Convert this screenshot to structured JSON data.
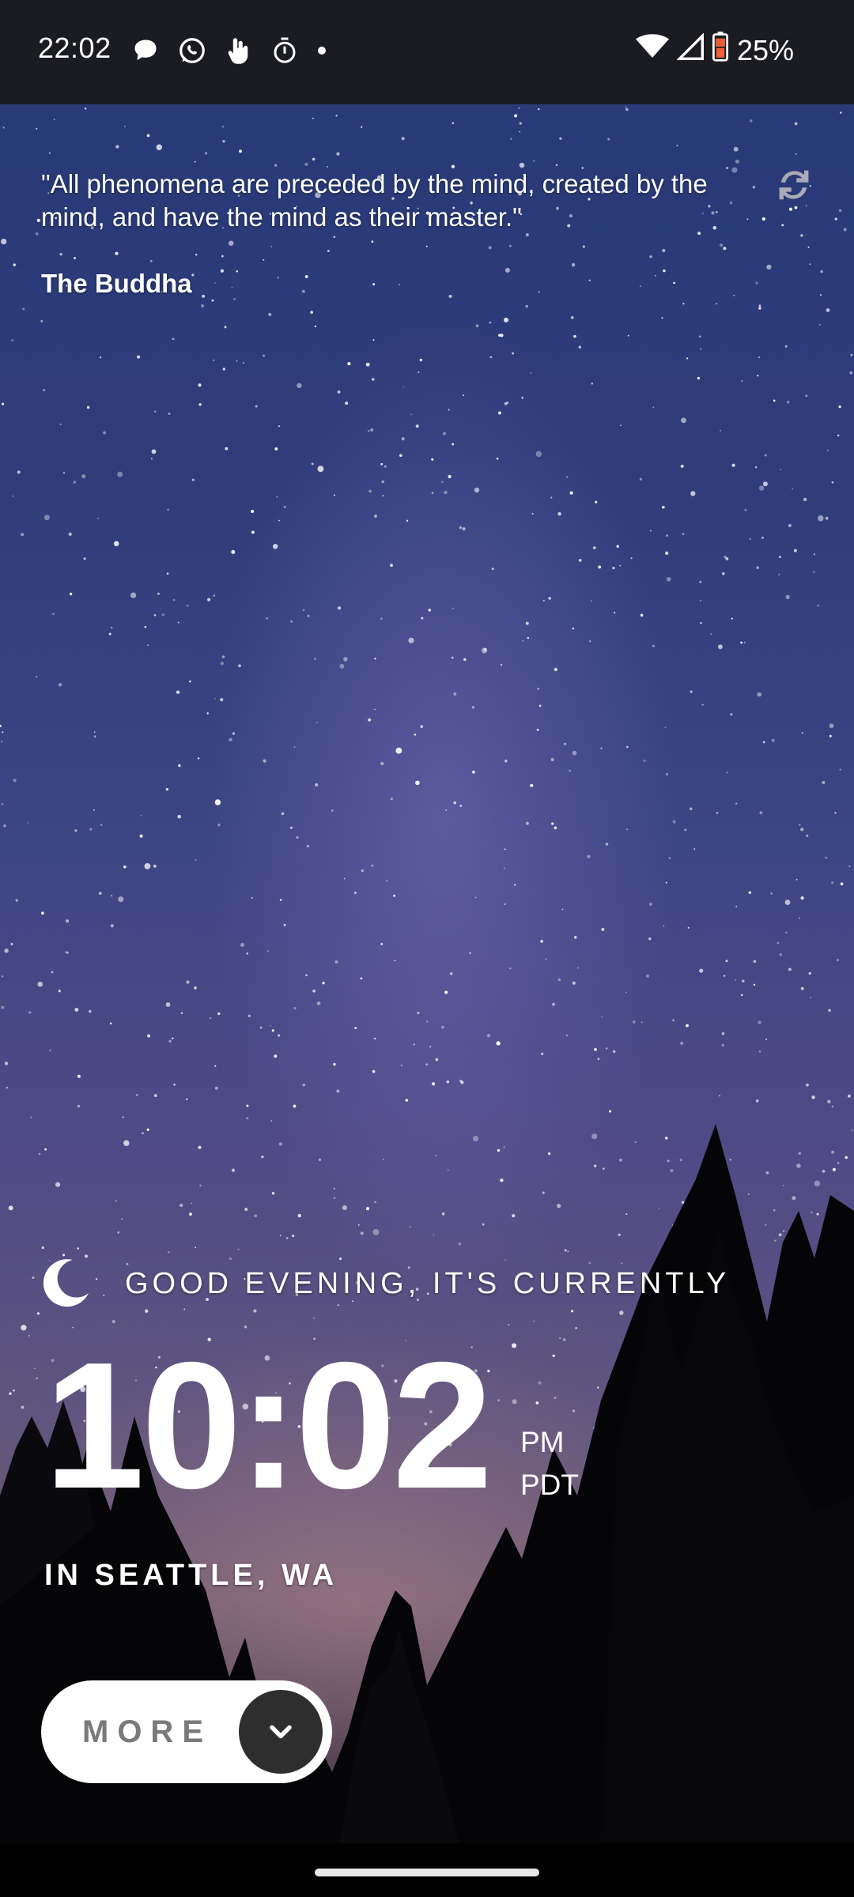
{
  "status_bar": {
    "time": "22:02",
    "battery_percent": "25%",
    "notification_icons": [
      "chat-bubble-icon",
      "whatsapp-icon",
      "touch-hand-icon",
      "timer-icon",
      "dot-icon"
    ],
    "system_icons": [
      "wifi-icon",
      "cell-signal-icon",
      "battery-icon"
    ],
    "battery_color": "#f0603a"
  },
  "quote": {
    "text": "\"All phenomena are preceded by the mind, created by the mind, and have the mind as their master.\"",
    "author": "The Buddha",
    "refresh_icon": "refresh-icon"
  },
  "greeting": {
    "icon": "moon-icon",
    "text": "GOOD EVENING, IT'S CURRENTLY"
  },
  "clock": {
    "time": "10:02",
    "meridiem": "PM",
    "timezone": "PDT"
  },
  "location": {
    "text": "IN SEATTLE, WA"
  },
  "more_button": {
    "label": "MORE",
    "icon": "chevron-down-icon"
  }
}
